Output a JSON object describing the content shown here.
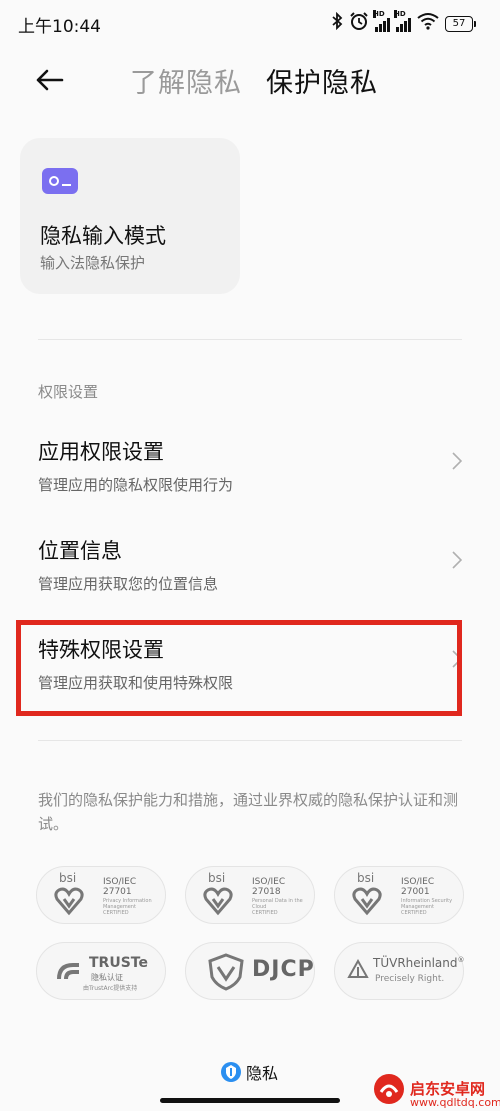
{
  "status_bar": {
    "time": "上午10:44",
    "battery": "57",
    "signal_tag": "HD",
    "icons": [
      "bluetooth-icon",
      "alarm-icon",
      "signal-icon",
      "wifi-icon",
      "battery-icon"
    ]
  },
  "nav": {
    "tabs": [
      {
        "label": "了解隐私",
        "active": false
      },
      {
        "label": "保护隐私",
        "active": true
      }
    ]
  },
  "privacy_card": {
    "title": "隐私输入模式",
    "subtitle": "输入法隐私保护",
    "icon": "keyboard-lock-icon",
    "icon_color": "#7b6ff0"
  },
  "permissions": {
    "section_label": "权限设置",
    "items": [
      {
        "title": "应用权限设置",
        "desc": "管理应用的隐私权限使用行为"
      },
      {
        "title": "位置信息",
        "desc": "管理应用获取您的位置信息"
      },
      {
        "title": "特殊权限设置",
        "desc": "管理应用获取和使用特殊权限"
      }
    ]
  },
  "highlight_color": "#e0281e",
  "certifications": {
    "intro": "我们的隐私保护能力和措施，通过业界权威的隐私保护认证和测试。",
    "badges": [
      {
        "brand": "bsi",
        "standard": "ISO/IEC",
        "code": "27701",
        "detail": "Privacy Information Management",
        "status": "CERTIFIED"
      },
      {
        "brand": "bsi",
        "standard": "ISO/IEC",
        "code": "27018",
        "detail": "Personal Data in the Cloud",
        "status": "CERTIFIED"
      },
      {
        "brand": "bsi",
        "standard": "ISO/IEC",
        "code": "27001",
        "detail": "Information Security Management",
        "status": "CERTIFIED"
      },
      {
        "brand": "TRUSTe",
        "line1": "隐私认证",
        "line2": "由TrustArc提供支持"
      },
      {
        "brand": "DJCP"
      },
      {
        "brand": "TÜVRheinland",
        "mark": "®",
        "tagline": "Precisely Right."
      }
    ]
  },
  "footer": {
    "brand_label": "隐私",
    "brand_icon": "shield-icon"
  },
  "watermark": {
    "name": "启东安卓网",
    "url": "www.qdltdq.com"
  }
}
